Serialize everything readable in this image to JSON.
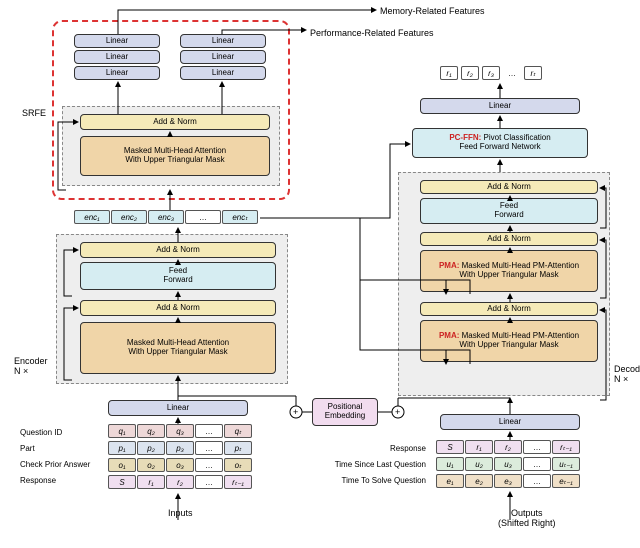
{
  "topLabels": {
    "memory": "Memory-Related Features",
    "performance": "Performance-Related Features"
  },
  "srfe": {
    "label": "SRFE",
    "linearBlocks": [
      "Linear",
      "Linear",
      "Linear",
      "Linear",
      "Linear",
      "Linear"
    ],
    "addnorm": "Add & Norm",
    "attn": "Masked Multi-Head Attention\nWith Upper Triangular Mask"
  },
  "encRow": [
    "enc₁",
    "enc₂",
    "enc₃",
    "…",
    "encₜ"
  ],
  "encoder": {
    "label": "Encoder\nN ×",
    "addnorm1": "Add & Norm",
    "ffw": "Feed\nForward",
    "addnorm2": "Add & Norm",
    "attn": "Masked Multi-Head Attention\nWith Upper Triangular Mask"
  },
  "posEmb": "Positional\nEmbedding",
  "decoder": {
    "label": "Decoder\nN ×",
    "addnorm3": "Add & Norm",
    "ffw": "Feed\nForward",
    "addnorm2": "Add & Norm",
    "pma2": {
      "prefix": "PMA: ",
      "text": "Masked Multi-Head PM-Attention\nWith Upper Triangular Mask"
    },
    "addnorm1": "Add & Norm",
    "pma1": {
      "prefix": "PMA: ",
      "text": "Masked Multi-Head PM-Attention\nWith Upper Triangular Mask"
    }
  },
  "outputTop": {
    "linear": "Linear",
    "pcffn": {
      "prefix": "PC-FFN: ",
      "text": "Pivot Classification\nFeed Forward Network"
    },
    "rRow": [
      "r₁",
      "r₂",
      "r₃",
      "…",
      "rₜ"
    ]
  },
  "inputs": {
    "linear": "Linear",
    "labels": [
      "Question ID",
      "Part",
      "Check Prior Answer",
      "Response"
    ],
    "rows": {
      "q": [
        "q₁",
        "q₂",
        "q₃",
        "…",
        "qₜ"
      ],
      "p": [
        "p₁",
        "p₂",
        "p₃",
        "…",
        "pₜ"
      ],
      "o": [
        "o₁",
        "o₂",
        "o₃",
        "…",
        "oₜ"
      ],
      "r": [
        "S",
        "r₁",
        "r₂",
        "…",
        "rₜ₋₁"
      ]
    },
    "arrow": "Inputs"
  },
  "outputs": {
    "linear": "Linear",
    "labels": [
      "Response",
      "Time Since Last Question",
      "Time To Solve Question"
    ],
    "rows": {
      "r": [
        "S",
        "r₁",
        "r₂",
        "…",
        "rₜ₋₁"
      ],
      "u": [
        "u₁",
        "u₂",
        "u₃",
        "…",
        "uₜ₋₁"
      ],
      "e": [
        "e₁",
        "e₂",
        "e₃",
        "…",
        "eₜ₋₁"
      ]
    },
    "arrow": "Outputs\n(Shifted Right)"
  }
}
